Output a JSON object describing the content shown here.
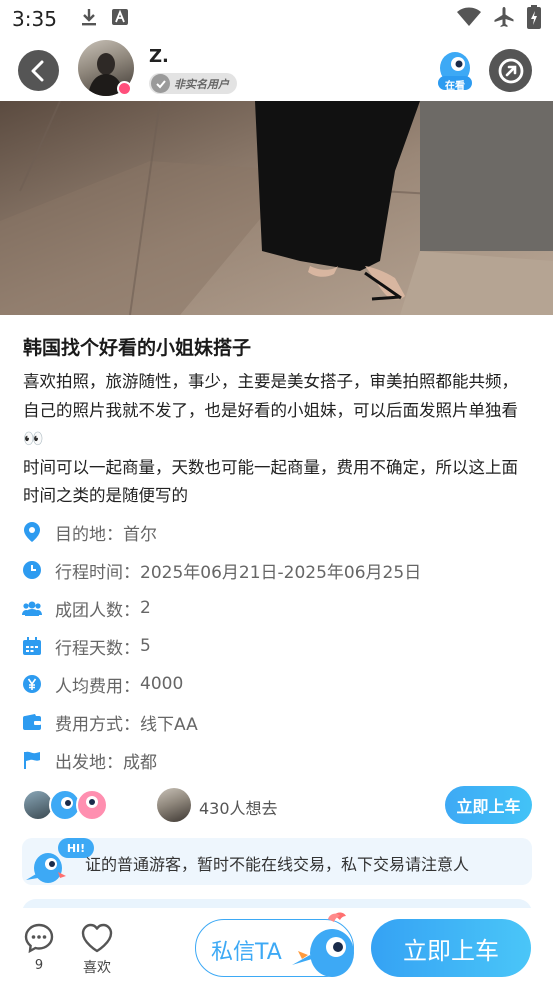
{
  "status_bar": {
    "time": "3:35",
    "icons_left": [
      "download-icon",
      "font-a-icon"
    ],
    "icons_right": [
      "wifi-icon",
      "airplane-icon",
      "battery-charging-icon"
    ]
  },
  "header": {
    "user_name": "Z.",
    "verify_badge": "非实名用户",
    "watching_label": "在看"
  },
  "post": {
    "title": "韩国找个好看的小姐妹搭子",
    "description": [
      "喜欢拍照，旅游随性，事少，主要是美女搭子，审美拍照都能共频，自己的照片我就不发了，也是好看的小姐妹，可以后面发照片单独看👀",
      "时间可以一起商量，天数也可能一起商量，费用不确定，所以这上面时间之类的是随便写的"
    ]
  },
  "trip_info": [
    {
      "icon": "location-pin-icon",
      "label": "目的地：",
      "value": "首尔"
    },
    {
      "icon": "clock-icon",
      "label": "行程时间：",
      "value": "2025年06月21日-2025年06月25日"
    },
    {
      "icon": "group-icon",
      "label": "成团人数：",
      "value": "2"
    },
    {
      "icon": "calendar-icon",
      "label": "行程天数：",
      "value": "5"
    },
    {
      "icon": "yuan-icon",
      "label": "人均费用：",
      "value": "4000"
    },
    {
      "icon": "wallet-icon",
      "label": "费用方式：",
      "value": "线下AA"
    },
    {
      "icon": "flag-icon",
      "label": "出发地：",
      "value": "成都"
    }
  ],
  "participants": {
    "want_count_text": "430人想去",
    "board_small_label": "立即上车"
  },
  "notice": {
    "hi": "HI!",
    "text": "证的普通游客，暂时不能在线交易，私下交易请注意人"
  },
  "bottom_bar": {
    "comment_count": "9",
    "like_label": "喜欢",
    "dm_label": "私信TA",
    "board_label": "立即上车"
  },
  "colors": {
    "accent_blue": "#3da9f5",
    "icon_blue": "#2d9bf0",
    "badge_pink": "#ff4f7b"
  }
}
